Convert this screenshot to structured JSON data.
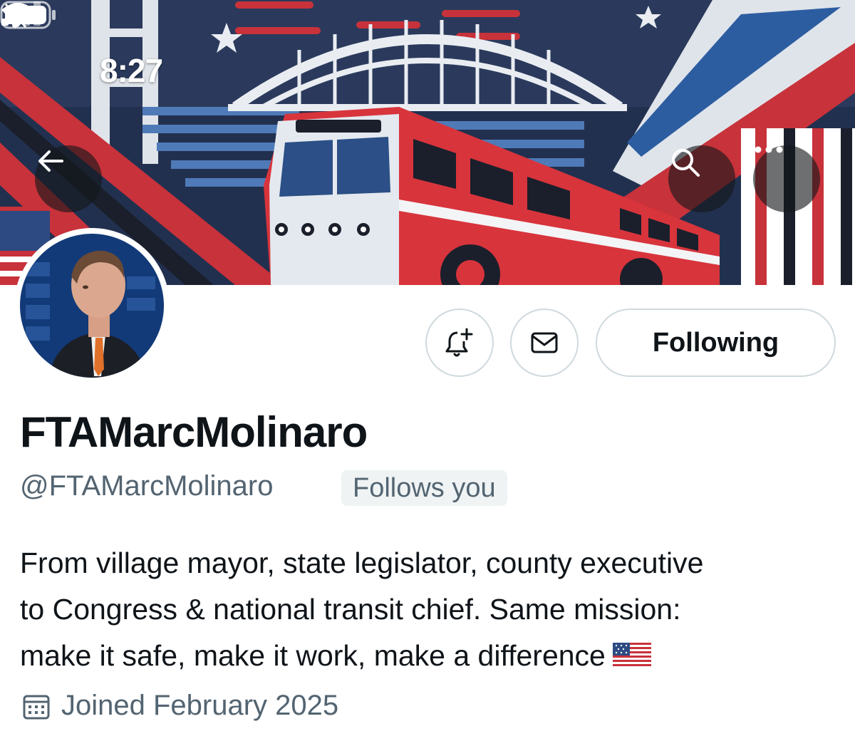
{
  "status_bar": {
    "time": "8:27"
  },
  "profile": {
    "display_name": "FTAMarcMolinaro",
    "handle": "@FTAMarcMolinaro",
    "follows_you_badge": "Follows you",
    "bio_lines": [
      "From village mayor, state legislator, county executive",
      "to Congress & national transit chief. Same mission:",
      "make it safe, make it work, make a difference"
    ],
    "joined": "Joined February 2025"
  },
  "actions": {
    "following_label": "Following"
  },
  "icons": {
    "back": "arrow-left-icon",
    "search": "search-icon",
    "more": "more-horizontal-icon",
    "notify": "bell-plus-icon",
    "message": "envelope-icon",
    "calendar": "calendar-icon",
    "flag": "us-flag-emoji"
  },
  "colors": {
    "text_primary": "#0f1419",
    "text_secondary": "#536471",
    "border": "#cfd9de",
    "badge_bg": "#eff3f4"
  }
}
